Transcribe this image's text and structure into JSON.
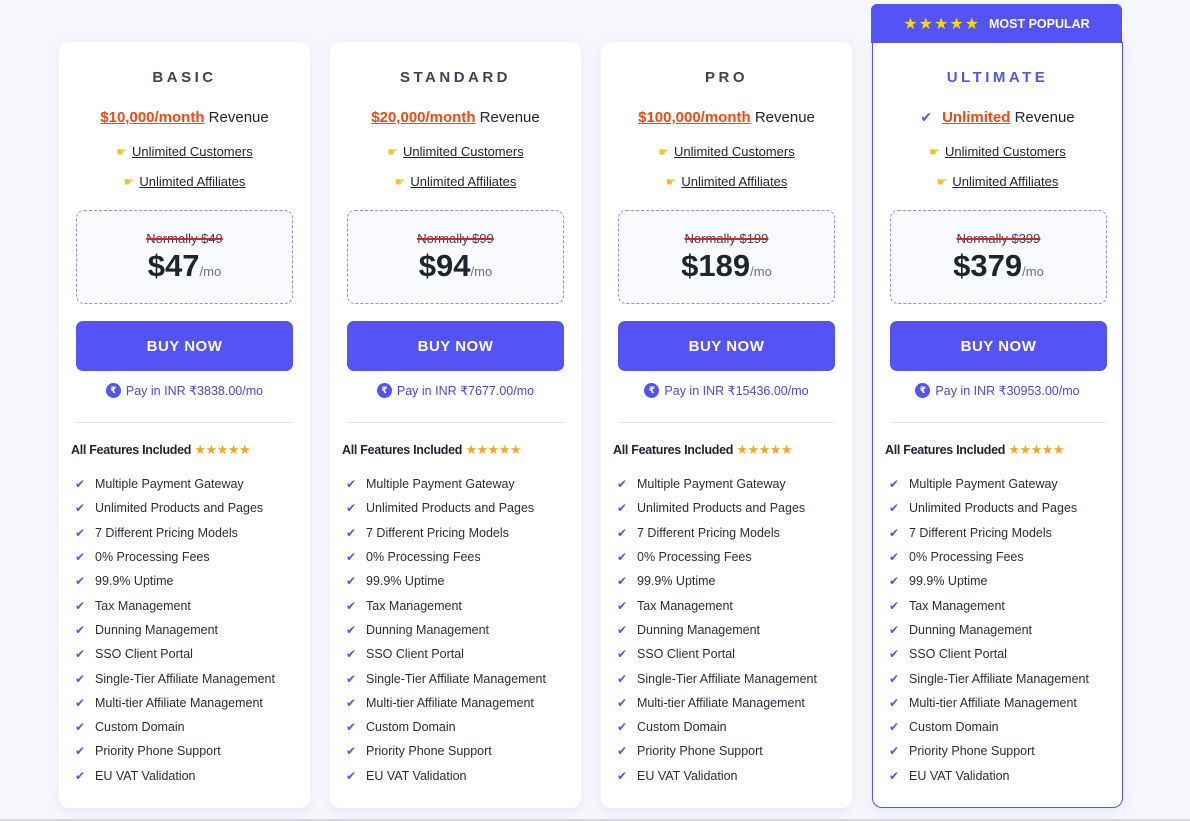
{
  "plans": [
    {
      "name": "BASIC",
      "revenue_amount": "$10,000/month",
      "revenue_label": "Revenue",
      "perks": [
        "Unlimited Customers",
        "Unlimited Affiliates"
      ],
      "normally": "Normally $49",
      "price": "$47",
      "per": "/mo",
      "buy_label": "BUY NOW",
      "inr": "Pay in INR ₹3838.00/mo"
    },
    {
      "name": "STANDARD",
      "revenue_amount": "$20,000/month",
      "revenue_label": "Revenue",
      "perks": [
        "Unlimited Customers",
        "Unlimited Affiliates"
      ],
      "normally": "Normally $99",
      "price": "$94",
      "per": "/mo",
      "buy_label": "BUY NOW",
      "inr": "Pay in INR ₹7677.00/mo"
    },
    {
      "name": "PRO",
      "revenue_amount": "$100,000/month",
      "revenue_label": "Revenue",
      "perks": [
        "Unlimited Customers",
        "Unlimited Affiliates"
      ],
      "normally": "Normally $199",
      "price": "$189",
      "per": "/mo",
      "buy_label": "BUY NOW",
      "inr": "Pay in INR ₹15436.00/mo"
    },
    {
      "name": "ULTIMATE",
      "revenue_amount": "Unlimited",
      "revenue_label": "Revenue",
      "perks": [
        "Unlimited Customers",
        "Unlimited Affiliates"
      ],
      "normally": "Normally $399",
      "price": "$379",
      "per": "/mo",
      "buy_label": "BUY NOW",
      "inr": "Pay in INR ₹30953.00/mo"
    }
  ],
  "popular_badge": {
    "stars": "★★★★★",
    "label": "MOST POPULAR"
  },
  "features_title": "All Features Included",
  "features_stars": "★★★★★",
  "features": [
    "Multiple Payment Gateway",
    "Unlimited Products and Pages",
    "7 Different Pricing Models",
    "0% Processing Fees",
    "99.9% Uptime",
    "Tax Management",
    "Dunning Management",
    "SSO Client Portal",
    "Single-Tier Affiliate Management",
    "Multi-tier Affiliate Management",
    "Custom Domain",
    "Priority Phone Support",
    "EU VAT Validation"
  ],
  "icons": {
    "check": "✔",
    "hand": "👉",
    "rupee": "₹"
  },
  "colors": {
    "accent": "#5353f7",
    "revenue": "#f04a0f",
    "star": "#f5a623",
    "badge_star": "#ffd600"
  }
}
